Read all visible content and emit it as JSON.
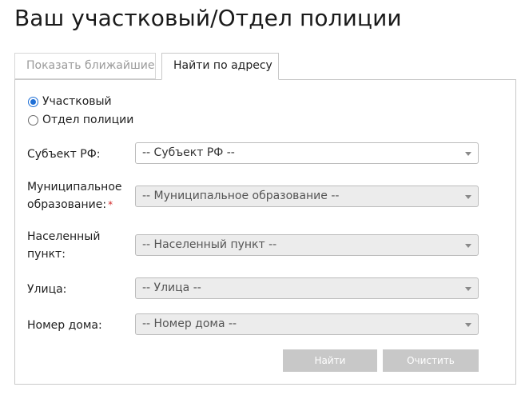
{
  "page": {
    "title": "Ваш участковый/Отдел полиции"
  },
  "tabs": [
    {
      "label": "Показать ближайшие",
      "active": false
    },
    {
      "label": "Найти по адресу",
      "active": true
    }
  ],
  "search_mode": {
    "options": [
      {
        "label": "Участковый",
        "checked": true
      },
      {
        "label": "Отдел полиции",
        "checked": false
      }
    ]
  },
  "fields": {
    "subject": {
      "label": "Субъект РФ:",
      "value": "-- Субъект РФ --",
      "enabled": true
    },
    "municipality": {
      "label_line1": "Муниципальное",
      "label_line2": "образование:",
      "required_mark": "*",
      "value": "-- Муниципальное образование --",
      "enabled": false
    },
    "settlement": {
      "label_line1": "Населенный",
      "label_line2": "пункт:",
      "value": "-- Населенный пункт --",
      "enabled": false
    },
    "street": {
      "label": "Улица:",
      "value": "-- Улица --",
      "enabled": false
    },
    "house": {
      "label": "Номер дома:",
      "value": "-- Номер дома --",
      "enabled": false
    }
  },
  "actions": {
    "find_label": "Найти",
    "clear_label": "Очистить"
  },
  "colors": {
    "radio_accent": "#1e6fd6",
    "required": "#d22a2a",
    "button_bg": "#c8c8c8",
    "disabled_select_bg": "#ececec"
  }
}
